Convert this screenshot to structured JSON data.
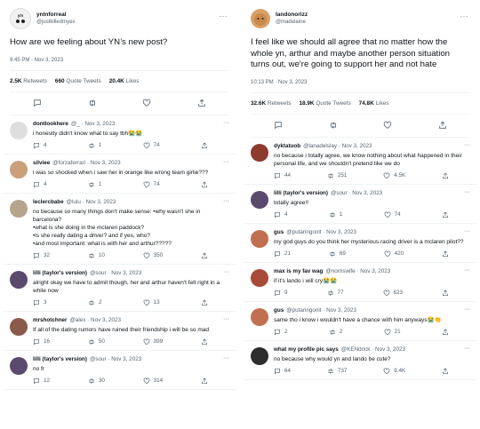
{
  "left": {
    "main": {
      "name": "ynlnforreal",
      "handle": "@justkilledmyex",
      "text": "How are we feeling about YN’s new post?",
      "time": "9:45 PM · Nov 3, 2023",
      "stats": {
        "retweets": "2.5K",
        "retweets_label": "Retweets",
        "quotes": "660",
        "quotes_label": "Quote Tweets",
        "likes": "20.4K",
        "likes_label": "Likes"
      }
    },
    "replies": [
      {
        "name": "dontlookhere",
        "meta": "@_ · Nov 3, 2023",
        "text": "i honestly didn't know what to say tbh😭😭",
        "reply": "4",
        "retweet": "1",
        "like": "74",
        "avatar": "#dedede"
      },
      {
        "name": "silviee",
        "meta": "@forzaferrari · Nov 3, 2023",
        "text": "i was so shocked when i saw her in orange like wrong team girlie???",
        "reply": "4",
        "retweet": "1",
        "like": "74",
        "avatar": "#c9a07a"
      },
      {
        "name": "leclercbabe",
        "meta": "@lulu · Nov 3, 2023",
        "text": "no because so many things don't make sense: •why wasn't she in barcelona?\n•what is she doing in the mclaren paddock?\n•is she really dating a driver? and if yes, who?\n•and most important: what is with her and arthur?????",
        "reply": "32",
        "retweet": "10",
        "like": "350",
        "avatar": "#b5a58c"
      },
      {
        "name": "lilli (taylor's version)",
        "meta": "@sour · Nov 3, 2023",
        "text": "alright okay we have to admit though, her and arthur haven't felt right in a while now",
        "reply": "3",
        "retweet": "2",
        "like": "13",
        "avatar": "#5a4a6e"
      },
      {
        "name": "mrshotchner",
        "meta": "@alex · Nov 3, 2023",
        "text": "If all of the dating rumors have ruined their friendship i will be so mad",
        "reply": "16",
        "retweet": "50",
        "like": "399",
        "avatar": "#8a5a4a"
      },
      {
        "name": "lilli (taylor's version)",
        "meta": "@sour · Nov 3, 2023",
        "text": "no fr",
        "reply": "12",
        "retweet": "30",
        "like": "314",
        "avatar": "#5a4a6e"
      }
    ]
  },
  "right": {
    "main": {
      "name": "landonorizz",
      "handle": "@madelaine",
      "text": "I feel like we should all agree that no matter how the whole yn, arthur and maybe another person situation turns out, we're going to support her and not hate",
      "time": "10:13 PM · Nov 3, 2023",
      "stats": {
        "retweets": "32.6K",
        "retweets_label": "Retweets",
        "quotes": "18.9K",
        "quotes_label": "Quote Tweets",
        "likes": "74.8K",
        "likes_label": "Likes"
      }
    },
    "replies": [
      {
        "name": "dyktatuob",
        "meta": "@lanadelslay · Nov 3, 2023",
        "text": "no because i totally agree, we know nothing about what happened in their personal life, and we shouldn't pretend like we do",
        "reply": "44",
        "retweet": "251",
        "like": "4.5K",
        "avatar": "#8c3b2e"
      },
      {
        "name": "lilli (taylor's version)",
        "meta": "@sour · Nov 3, 2023",
        "text": "totally agree!!",
        "reply": "4",
        "retweet": "1",
        "like": "74",
        "avatar": "#5a4a6e"
      },
      {
        "name": "gus",
        "meta": "@putaringonit · Nov 3, 2023",
        "text": "my god guys do you think her mysterious racing driver is a mclaren pilot??",
        "reply": "21",
        "retweet": "69",
        "like": "420",
        "avatar": "#c07050"
      },
      {
        "name": "max is my fav wag",
        "meta": "@norriswife · Nov 3, 2023",
        "text": "if it's lando i will cry😭😭",
        "reply": "9",
        "retweet": "77",
        "like": "623",
        "avatar": "#a84a3a"
      },
      {
        "name": "gus",
        "meta": "@putaringonit · Nov 3, 2023",
        "text": "same tho i know i wouldn't have a chance with him anyways😭👏",
        "reply": "2",
        "retweet": "2",
        "like": "21",
        "avatar": "#c07050"
      },
      {
        "name": "what my profile pic says",
        "meta": "@KENdrick · Nov 3, 2023",
        "text": "no because why would yn and lando be cute?",
        "reply": "64",
        "retweet": "737",
        "like": "9.4K",
        "avatar": "#2e2e2e"
      }
    ]
  },
  "icons": {
    "reply": "reply-icon",
    "retweet": "retweet-icon",
    "like": "heart-icon",
    "share": "share-icon",
    "more": "more-icon"
  }
}
